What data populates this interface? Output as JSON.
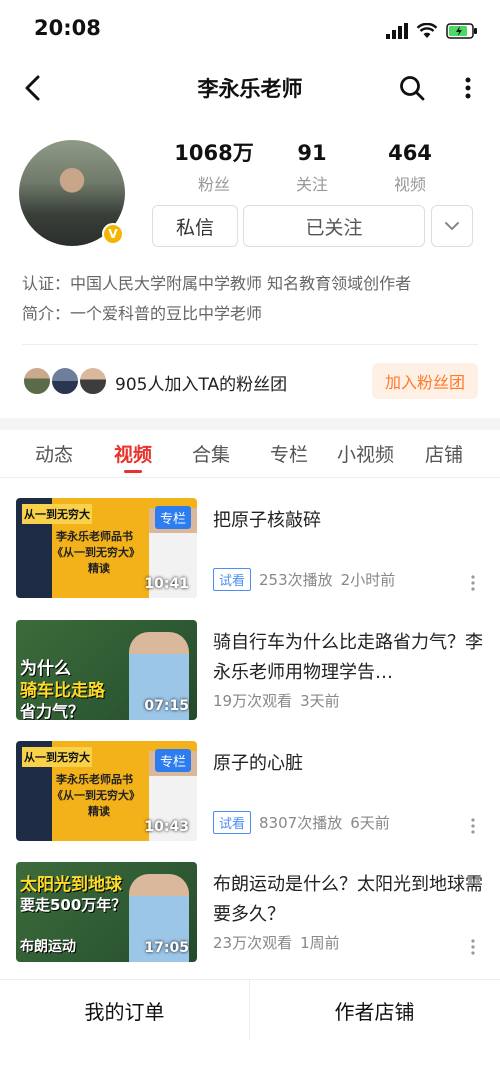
{
  "status": {
    "time": "20:08"
  },
  "nav": {
    "title": "李永乐老师"
  },
  "profile": {
    "stats": [
      {
        "value": "1068万",
        "label": "粉丝"
      },
      {
        "value": "91",
        "label": "关注"
      },
      {
        "value": "464",
        "label": "视频"
      }
    ],
    "message_label": "私信",
    "follow_label": "已关注",
    "verify": "认证：中国人民大学附属中学教师 知名教育领域创作者",
    "bio": "简介：一个爱科普的豆比中学老师"
  },
  "fans": {
    "text": "905人加入TA的粉丝团",
    "join_label": "加入粉丝团"
  },
  "tabs": [
    "动态",
    "视频",
    "合集",
    "专栏",
    "小视频",
    "店铺"
  ],
  "videos": [
    {
      "title": "把原子核敲碎",
      "tag": "试看",
      "views": "253次播放",
      "time": "2小时前",
      "duration": "10:41",
      "badge": "专栏",
      "thumb_text": [
        "从一到无穷大",
        "李永乐老师品书",
        "《从一到无穷大》",
        "精读"
      ]
    },
    {
      "title": "骑自行车为什么比走路省力气？李永乐老师用物理学告…",
      "tag": "",
      "views": "19万次观看",
      "time": "3天前",
      "duration": "07:15",
      "badge": "",
      "thumb_text": [
        "为什么",
        "骑车比走路",
        "省力气？"
      ]
    },
    {
      "title": "原子的心脏",
      "tag": "试看",
      "views": "8307次播放",
      "time": "6天前",
      "duration": "10:43",
      "badge": "专栏",
      "thumb_text": [
        "从一到无穷大",
        "李永乐老师品书",
        "《从一到无穷大》",
        "精读"
      ]
    },
    {
      "title": "布朗运动是什么？太阳光到地球需要多久？",
      "tag": "",
      "views": "23万次观看",
      "time": "1周前",
      "duration": "17:05",
      "badge": "",
      "thumb_text": [
        "太阳光到地球",
        "要走500万年？",
        "布朗运动"
      ]
    }
  ],
  "bottom": {
    "orders_label": "我的订单",
    "shop_label": "作者店铺"
  },
  "colors": {
    "accent": "#e8322b",
    "tag_blue": "#2d7cf0",
    "fan_btn": "#ff7a2b"
  }
}
